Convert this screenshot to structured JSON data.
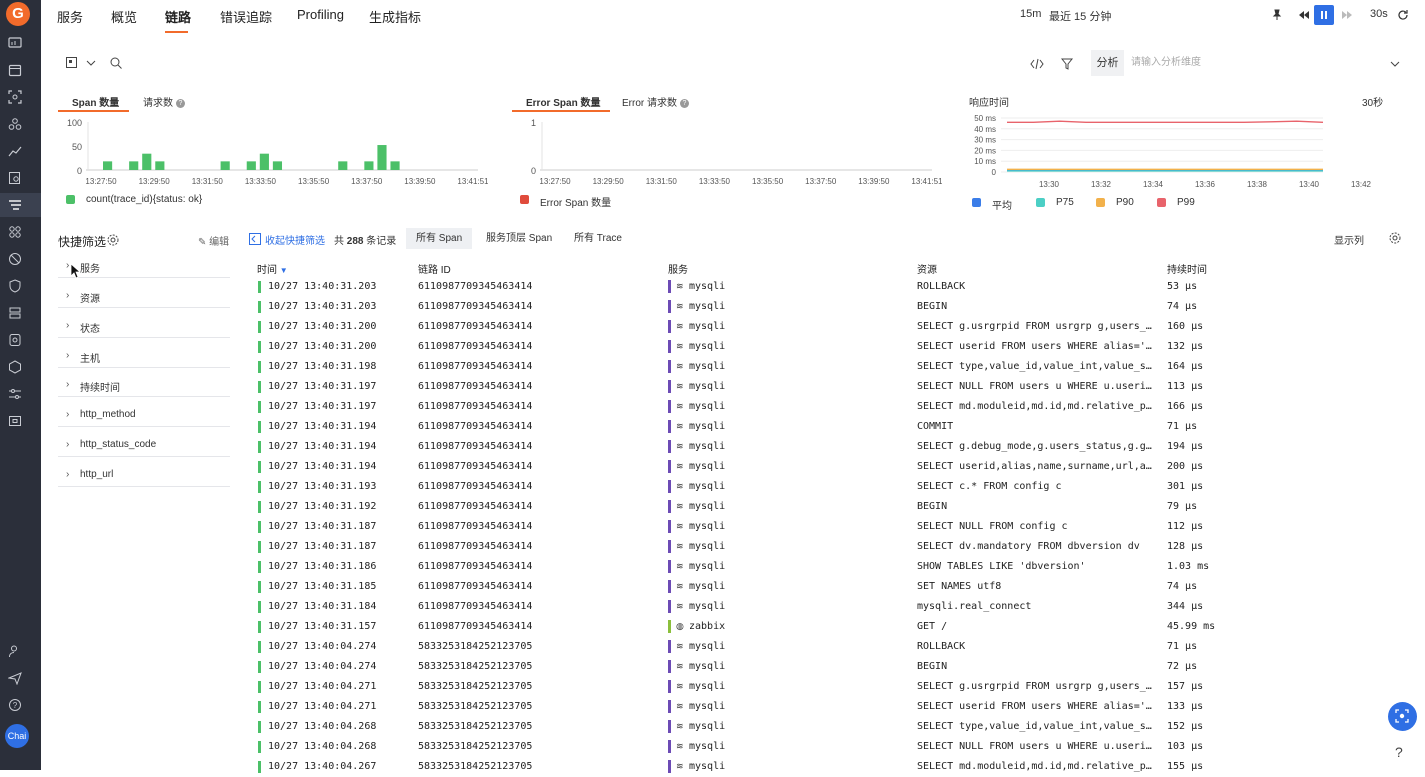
{
  "sidebar": {
    "logo": "G",
    "avatar": "Chai"
  },
  "topnav": {
    "tabs": [
      {
        "label": "服务"
      },
      {
        "label": "概览"
      },
      {
        "label": "链路"
      },
      {
        "label": "错误追踪"
      },
      {
        "label": "Profiling"
      },
      {
        "label": "生成指标"
      }
    ],
    "active_tab": "链路",
    "time_short": "15m",
    "time_range": "最近 15 分钟",
    "refresh_interval": "30s"
  },
  "query": {
    "analyze_label": "分析",
    "analyze_placeholder": "请输入分析维度"
  },
  "chart_span": {
    "tabs": [
      "Span 数量",
      "请求数"
    ],
    "legend": "count(trace_id){status: ok}"
  },
  "chart_error": {
    "tabs": [
      "Error Span 数量",
      "Error 请求数"
    ],
    "legend": "Error Span 数量"
  },
  "chart_latency": {
    "title": "响应时间",
    "interval": "30秒",
    "legend": [
      "平均",
      "P75",
      "P90",
      "P99"
    ]
  },
  "chart_data": [
    {
      "type": "bar",
      "title": "Span 数量",
      "x_ticks": [
        "13:27:50",
        "13:29:50",
        "13:31:50",
        "13:33:50",
        "13:35:50",
        "13:37:50",
        "13:39:50",
        "13:41:51"
      ],
      "y_ticks": [
        0,
        50,
        100
      ],
      "ylim": [
        0,
        100
      ],
      "series": [
        {
          "name": "count(trace_id){status: ok}",
          "color": "#4cc068",
          "values": [
            18,
            0,
            18,
            34,
            18,
            0,
            0,
            0,
            0,
            18,
            0,
            18,
            34,
            18,
            0,
            0,
            0,
            0,
            18,
            0,
            18,
            52,
            18,
            0,
            0,
            0
          ]
        }
      ]
    },
    {
      "type": "bar",
      "title": "Error Span 数量",
      "x_ticks": [
        "13:27:50",
        "13:29:50",
        "13:31:50",
        "13:33:50",
        "13:35:50",
        "13:37:50",
        "13:39:50",
        "13:41:51"
      ],
      "y_ticks": [
        0,
        1
      ],
      "ylim": [
        0,
        1
      ],
      "series": [
        {
          "name": "Error Span 数量",
          "color": "#e04b3c",
          "values": []
        }
      ]
    },
    {
      "type": "line",
      "title": "响应时间",
      "x_ticks": [
        "13:30",
        "13:32",
        "13:34",
        "13:36",
        "13:38",
        "13:40",
        "13:42"
      ],
      "y_ticks": [
        "0",
        "10 ms",
        "20 ms",
        "30 ms",
        "40 ms",
        "50 ms"
      ],
      "ylim": [
        0,
        50
      ],
      "series": [
        {
          "name": "平均",
          "color": "#3b7de8",
          "values": [
            1.5,
            1.5,
            1.5,
            1.5,
            1.5,
            1.5,
            1.5,
            1.5,
            1.5,
            1.5,
            1.5,
            1.5
          ]
        },
        {
          "name": "P75",
          "color": "#4ccfc5",
          "values": [
            1,
            1,
            1,
            1,
            1,
            1,
            1,
            1,
            1,
            1,
            1,
            1
          ]
        },
        {
          "name": "P90",
          "color": "#f2b14b",
          "values": [
            2.5,
            2.5,
            2.5,
            2.5,
            2.5,
            2.5,
            2.5,
            2.5,
            2.5,
            2.5,
            2.5,
            2.5
          ]
        },
        {
          "name": "P99",
          "color": "#e8636b",
          "values": [
            46,
            46,
            47,
            46,
            46,
            46,
            46,
            46,
            46,
            46,
            46.5,
            47,
            46
          ]
        }
      ]
    }
  ],
  "filters": {
    "title": "快捷筛选",
    "edit": "编辑",
    "collapse": "收起快捷筛选",
    "facets": [
      "服务",
      "资源",
      "状态",
      "主机",
      "持续时间",
      "http_method",
      "http_status_code",
      "http_url"
    ]
  },
  "toolbar": {
    "count_prefix": "共",
    "count": "288",
    "count_suffix": "条记录",
    "segments": [
      "所有 Span",
      "服务顶层 Span",
      "所有 Trace"
    ],
    "columns_label": "显示列"
  },
  "table": {
    "headers": [
      "时间",
      "链路 ID",
      "服务",
      "资源",
      "持续时间"
    ],
    "rows": [
      {
        "time": "10/27 13:40:31.203",
        "trace": "6110987709345463414",
        "service": "mysqli",
        "resource": "ROLLBACK",
        "duration": "53 μs"
      },
      {
        "time": "10/27 13:40:31.203",
        "trace": "6110987709345463414",
        "service": "mysqli",
        "resource": "BEGIN",
        "duration": "74 μs"
      },
      {
        "time": "10/27 13:40:31.200",
        "trace": "6110987709345463414",
        "service": "mysqli",
        "resource": "SELECT g.usrgrpid FROM usrgrp g,users_…",
        "duration": "160 μs"
      },
      {
        "time": "10/27 13:40:31.200",
        "trace": "6110987709345463414",
        "service": "mysqli",
        "resource": "SELECT userid FROM users WHERE alias='…",
        "duration": "132 μs"
      },
      {
        "time": "10/27 13:40:31.198",
        "trace": "6110987709345463414",
        "service": "mysqli",
        "resource": "SELECT type,value_id,value_int,value_s…",
        "duration": "164 μs"
      },
      {
        "time": "10/27 13:40:31.197",
        "trace": "6110987709345463414",
        "service": "mysqli",
        "resource": "SELECT NULL FROM users u WHERE u.useri…",
        "duration": "113 μs"
      },
      {
        "time": "10/27 13:40:31.197",
        "trace": "6110987709345463414",
        "service": "mysqli",
        "resource": "SELECT md.moduleid,md.id,md.relative_p…",
        "duration": "166 μs"
      },
      {
        "time": "10/27 13:40:31.194",
        "trace": "6110987709345463414",
        "service": "mysqli",
        "resource": "COMMIT",
        "duration": "71 μs"
      },
      {
        "time": "10/27 13:40:31.194",
        "trace": "6110987709345463414",
        "service": "mysqli",
        "resource": "SELECT g.debug_mode,g.users_status,g.g…",
        "duration": "194 μs"
      },
      {
        "time": "10/27 13:40:31.194",
        "trace": "6110987709345463414",
        "service": "mysqli",
        "resource": "SELECT userid,alias,name,surname,url,a…",
        "duration": "200 μs"
      },
      {
        "time": "10/27 13:40:31.193",
        "trace": "6110987709345463414",
        "service": "mysqli",
        "resource": "SELECT c.* FROM config c",
        "duration": "301 μs"
      },
      {
        "time": "10/27 13:40:31.192",
        "trace": "6110987709345463414",
        "service": "mysqli",
        "resource": "BEGIN",
        "duration": "79 μs"
      },
      {
        "time": "10/27 13:40:31.187",
        "trace": "6110987709345463414",
        "service": "mysqli",
        "resource": "SELECT NULL FROM config c",
        "duration": "112 μs"
      },
      {
        "time": "10/27 13:40:31.187",
        "trace": "6110987709345463414",
        "service": "mysqli",
        "resource": "SELECT dv.mandatory FROM dbversion dv",
        "duration": "128 μs"
      },
      {
        "time": "10/27 13:40:31.186",
        "trace": "6110987709345463414",
        "service": "mysqli",
        "resource": "SHOW TABLES LIKE 'dbversion'",
        "duration": "1.03 ms"
      },
      {
        "time": "10/27 13:40:31.185",
        "trace": "6110987709345463414",
        "service": "mysqli",
        "resource": "SET NAMES utf8",
        "duration": "74 μs"
      },
      {
        "time": "10/27 13:40:31.184",
        "trace": "6110987709345463414",
        "service": "mysqli",
        "resource": "mysqli.real_connect",
        "duration": "344 μs"
      },
      {
        "time": "10/27 13:40:31.157",
        "trace": "6110987709345463414",
        "service": "zabbix",
        "resource": "GET /",
        "duration": "45.99 ms"
      },
      {
        "time": "10/27 13:40:04.274",
        "trace": "5833253184252123705",
        "service": "mysqli",
        "resource": "ROLLBACK",
        "duration": "71 μs"
      },
      {
        "time": "10/27 13:40:04.274",
        "trace": "5833253184252123705",
        "service": "mysqli",
        "resource": "BEGIN",
        "duration": "72 μs"
      },
      {
        "time": "10/27 13:40:04.271",
        "trace": "5833253184252123705",
        "service": "mysqli",
        "resource": "SELECT g.usrgrpid FROM usrgrp g,users_…",
        "duration": "157 μs"
      },
      {
        "time": "10/27 13:40:04.271",
        "trace": "5833253184252123705",
        "service": "mysqli",
        "resource": "SELECT userid FROM users WHERE alias='…",
        "duration": "133 μs"
      },
      {
        "time": "10/27 13:40:04.268",
        "trace": "5833253184252123705",
        "service": "mysqli",
        "resource": "SELECT type,value_id,value_int,value_s…",
        "duration": "152 μs"
      },
      {
        "time": "10/27 13:40:04.268",
        "trace": "5833253184252123705",
        "service": "mysqli",
        "resource": "SELECT NULL FROM users u WHERE u.useri…",
        "duration": "103 μs"
      },
      {
        "time": "10/27 13:40:04.267",
        "trace": "5833253184252123705",
        "service": "mysqli",
        "resource": "SELECT md.moduleid,md.id,md.relative_p…",
        "duration": "155 μs"
      }
    ]
  },
  "colors": {
    "accent": "#f26b2b",
    "primary": "#2f6fe4",
    "ok": "#4cc068",
    "mysqli": "#6c4bb5",
    "zabbix": "#8bbf3c"
  }
}
